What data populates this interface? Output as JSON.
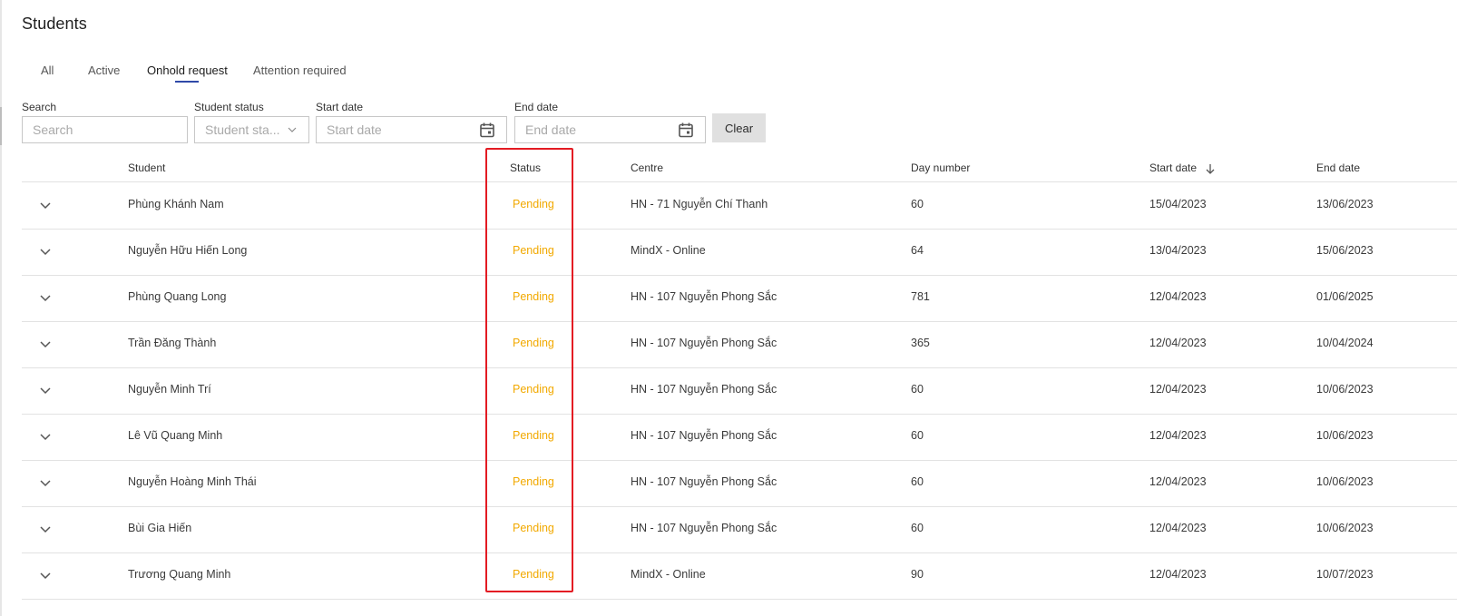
{
  "page": {
    "title": "Students"
  },
  "tabs": [
    {
      "label": "All",
      "active": false
    },
    {
      "label": "Active",
      "active": false
    },
    {
      "label": "Onhold request",
      "active": true
    },
    {
      "label": "Attention required",
      "active": false
    }
  ],
  "filters": {
    "search": {
      "label": "Search",
      "placeholder": "Search",
      "value": ""
    },
    "student_status": {
      "label": "Student status",
      "placeholder": "Student sta..."
    },
    "start_date": {
      "label": "Start date",
      "placeholder": "Start date"
    },
    "end_date": {
      "label": "End date",
      "placeholder": "End date"
    },
    "clear_label": "Clear"
  },
  "table": {
    "columns": {
      "student": "Student",
      "status": "Status",
      "centre": "Centre",
      "day_number": "Day number",
      "start_date": "Start date",
      "end_date": "End date"
    },
    "sort": {
      "column": "start_date",
      "direction": "descending",
      "icon": "arrow-down-icon"
    },
    "rows": [
      {
        "student": "Phùng Khánh Nam",
        "status": "Pending",
        "centre": "HN - 71 Nguyễn Chí Thanh",
        "day_number": "60",
        "start_date": "15/04/2023",
        "end_date": "13/06/2023"
      },
      {
        "student": "Nguyễn Hữu Hiến Long",
        "status": "Pending",
        "centre": "MindX - Online",
        "day_number": "64",
        "start_date": "13/04/2023",
        "end_date": "15/06/2023"
      },
      {
        "student": "Phùng Quang Long",
        "status": "Pending",
        "centre": "HN - 107 Nguyễn Phong Sắc",
        "day_number": "781",
        "start_date": "12/04/2023",
        "end_date": "01/06/2025"
      },
      {
        "student": "Trần Đăng Thành",
        "status": "Pending",
        "centre": "HN - 107 Nguyễn Phong Sắc",
        "day_number": "365",
        "start_date": "12/04/2023",
        "end_date": "10/04/2024"
      },
      {
        "student": "Nguyễn Minh Trí",
        "status": "Pending",
        "centre": "HN - 107 Nguyễn Phong Sắc",
        "day_number": "60",
        "start_date": "12/04/2023",
        "end_date": "10/06/2023"
      },
      {
        "student": "Lê Vũ Quang Minh",
        "status": "Pending",
        "centre": "HN - 107 Nguyễn Phong Sắc",
        "day_number": "60",
        "start_date": "12/04/2023",
        "end_date": "10/06/2023"
      },
      {
        "student": "Nguyễn Hoàng Minh Thái",
        "status": "Pending",
        "centre": "HN - 107 Nguyễn Phong Sắc",
        "day_number": "60",
        "start_date": "12/04/2023",
        "end_date": "10/06/2023"
      },
      {
        "student": "Bùi Gia Hiến",
        "status": "Pending",
        "centre": "HN - 107 Nguyễn Phong Sắc",
        "day_number": "60",
        "start_date": "12/04/2023",
        "end_date": "10/06/2023"
      },
      {
        "student": "Trương Quang Minh",
        "status": "Pending",
        "centre": "MindX - Online",
        "day_number": "90",
        "start_date": "12/04/2023",
        "end_date": "10/07/2023"
      }
    ]
  },
  "colors": {
    "accent": "#2f49a8",
    "pending": "#f2a900",
    "highlight": "#e31b23",
    "clear_button": "#e0e0e0"
  },
  "icons": [
    "calendar-icon",
    "chevron-down-icon",
    "arrow-down-icon"
  ]
}
